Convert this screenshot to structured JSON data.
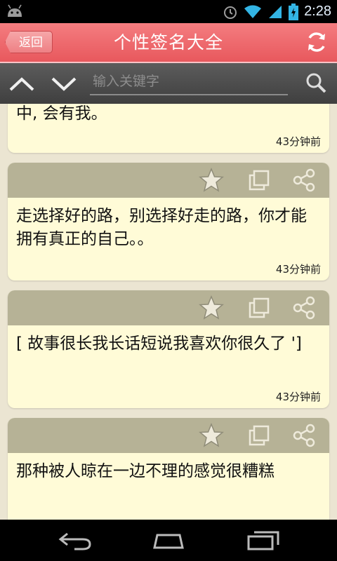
{
  "status_bar": {
    "time": "2:28"
  },
  "header": {
    "back_label": "返回",
    "title": "个性签名大全"
  },
  "search": {
    "placeholder": "输入关键字"
  },
  "cards": [
    {
      "text": "中, 会有我。",
      "time": "43分钟前"
    },
    {
      "text": "走选择好的路，别选择好走的路，你才能拥有真正的自己。。",
      "time": "43分钟前"
    },
    {
      "text": "[ 故事很长我长话短说我喜欢你很久了 ']",
      "time": "43分钟前"
    },
    {
      "text": "那种被人晾在一边不理的感觉很糟糕",
      "time": ""
    }
  ],
  "colors": {
    "title_bar": "#e8585d",
    "card_toolbar": "#b6b296",
    "card_bg": "#fffbd7",
    "status_icons": "#33b5e5"
  }
}
